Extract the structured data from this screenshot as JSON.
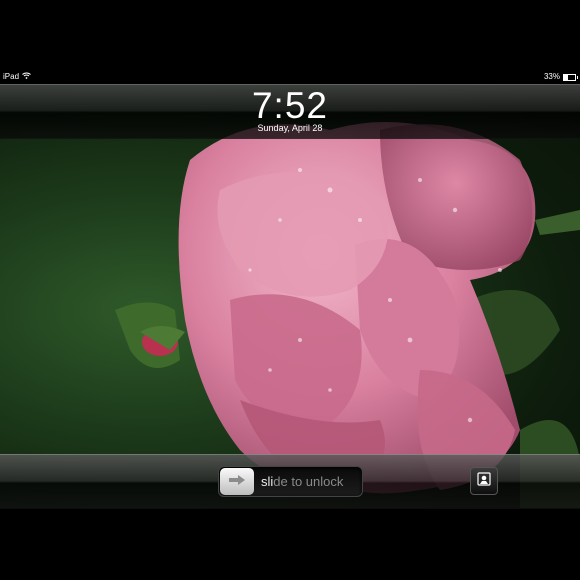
{
  "status_bar": {
    "device": "iPad",
    "battery": "33%",
    "battery_level": 0.33,
    "wifi_icon": "wifi-icon"
  },
  "lock_screen": {
    "time": "7:52",
    "date": "Sunday, April 28"
  },
  "unlock_slider": {
    "label_highlight": "sli",
    "label_rest": "de to unlock",
    "knob_icon": "arrow-right-icon"
  },
  "picture_frame_button": {
    "icon": "picture-frame-icon"
  },
  "wallpaper": {
    "subject": "pink-rose",
    "petal_color": "#d9809f",
    "background_color": "#1c3a1a"
  }
}
